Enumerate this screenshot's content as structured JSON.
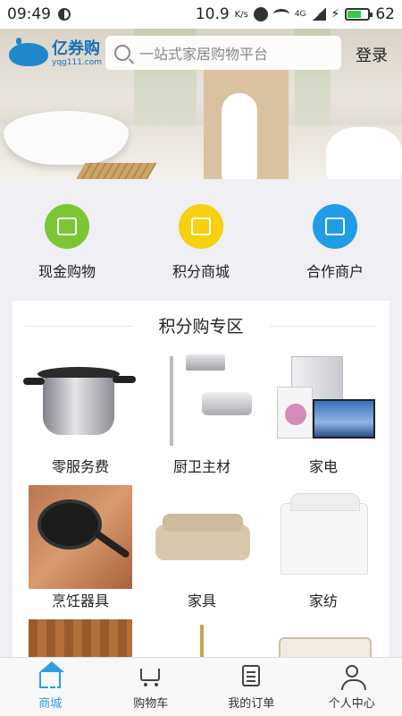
{
  "status_bar": {
    "time": "09:49",
    "speed": "10.9",
    "speed_unit": "K/s",
    "network": "4G",
    "battery": "62"
  },
  "header": {
    "logo_name": "亿券购",
    "logo_url": "yqg111.com",
    "search_placeholder": "一站式家居购物平台",
    "login_label": "登录"
  },
  "quick_entries": [
    {
      "label": "现金购物",
      "color": "#7cc633",
      "icon": "shopping-bag-icon"
    },
    {
      "label": "积分商城",
      "color": "#f5d10f",
      "icon": "gift-icon"
    },
    {
      "label": "合作商户",
      "color": "#1f9de6",
      "icon": "store-icon"
    }
  ],
  "zone": {
    "title": "积分购专区",
    "items": [
      {
        "label": "零服务费"
      },
      {
        "label": "厨卫主材"
      },
      {
        "label": "家电"
      },
      {
        "label": "烹饪器具"
      },
      {
        "label": "家具"
      },
      {
        "label": "家纺"
      },
      {
        "label": ""
      },
      {
        "label": ""
      },
      {
        "label": ""
      }
    ]
  },
  "bottom_nav": [
    {
      "label": "商城",
      "icon": "home-icon",
      "active": true
    },
    {
      "label": "购物车",
      "icon": "cart-icon",
      "active": false
    },
    {
      "label": "我的订单",
      "icon": "order-list-icon",
      "active": false
    },
    {
      "label": "个人中心",
      "icon": "user-icon",
      "active": false
    }
  ],
  "colors": {
    "accent": "#2f9de0",
    "background": "#efeff4"
  }
}
